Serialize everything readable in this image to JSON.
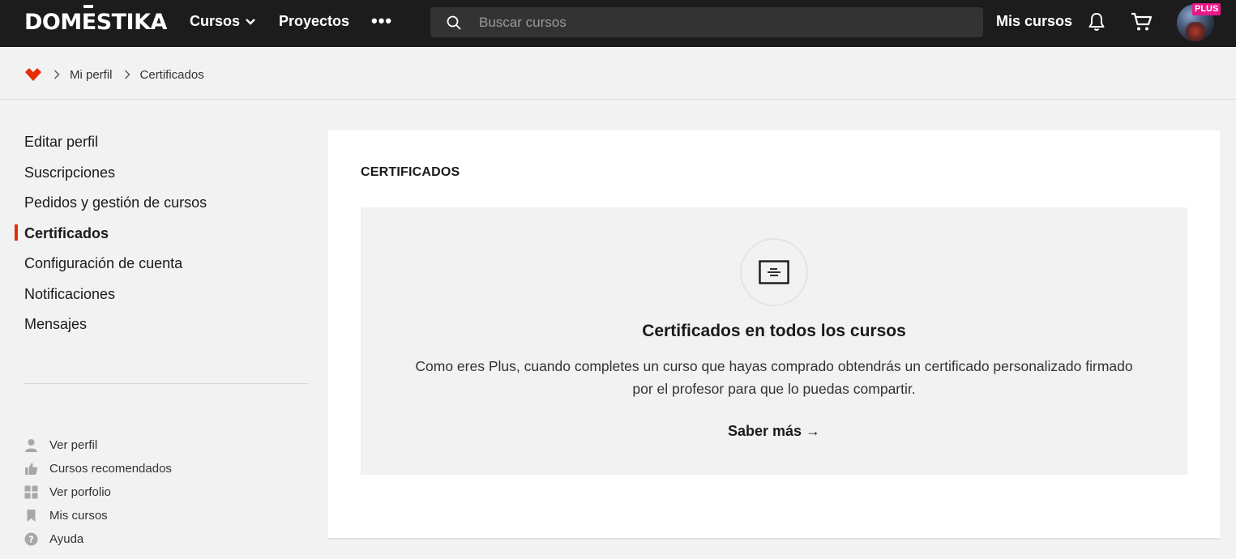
{
  "header": {
    "logo_text": "DOMESTIKA",
    "nav": {
      "cursos_label": "Cursos",
      "proyectos_label": "Proyectos",
      "more_label": "•••"
    },
    "search": {
      "placeholder": "Buscar cursos",
      "value": ""
    },
    "mis_cursos_label": "Mis cursos",
    "plus_badge": "PLUS",
    "icons": [
      "search-icon",
      "bell-icon",
      "cart-icon",
      "chevron-down-icon"
    ]
  },
  "breadcrumb": {
    "items": [
      "Mi perfil",
      "Certificados"
    ]
  },
  "sidebar": {
    "menu": [
      {
        "label": "Editar perfil",
        "active": false
      },
      {
        "label": "Suscripciones",
        "active": false
      },
      {
        "label": "Pedidos y gestión de cursos",
        "active": false
      },
      {
        "label": "Certificados",
        "active": true
      },
      {
        "label": "Configuración de cuenta",
        "active": false
      },
      {
        "label": "Notificaciones",
        "active": false
      },
      {
        "label": "Mensajes",
        "active": false
      }
    ],
    "links": [
      {
        "label": "Ver perfil",
        "icon": "user-icon"
      },
      {
        "label": "Cursos recomendados",
        "icon": "thumbs-up-icon"
      },
      {
        "label": "Ver porfolio",
        "icon": "grid-icon"
      },
      {
        "label": "Mis cursos",
        "icon": "bookmark-icon"
      },
      {
        "label": "Ayuda",
        "icon": "help-icon"
      }
    ],
    "accent_color": "#e62e05"
  },
  "main": {
    "title": "CERTIFICADOS",
    "promo": {
      "icon": "certificate-icon",
      "heading": "Certificados en todos los cursos",
      "text": "Como eres Plus, cuando completes un curso que hayas comprado obtendrás un certificado personalizado firmado por el profesor para que lo puedas compartir.",
      "link_label": "Saber más →"
    }
  }
}
